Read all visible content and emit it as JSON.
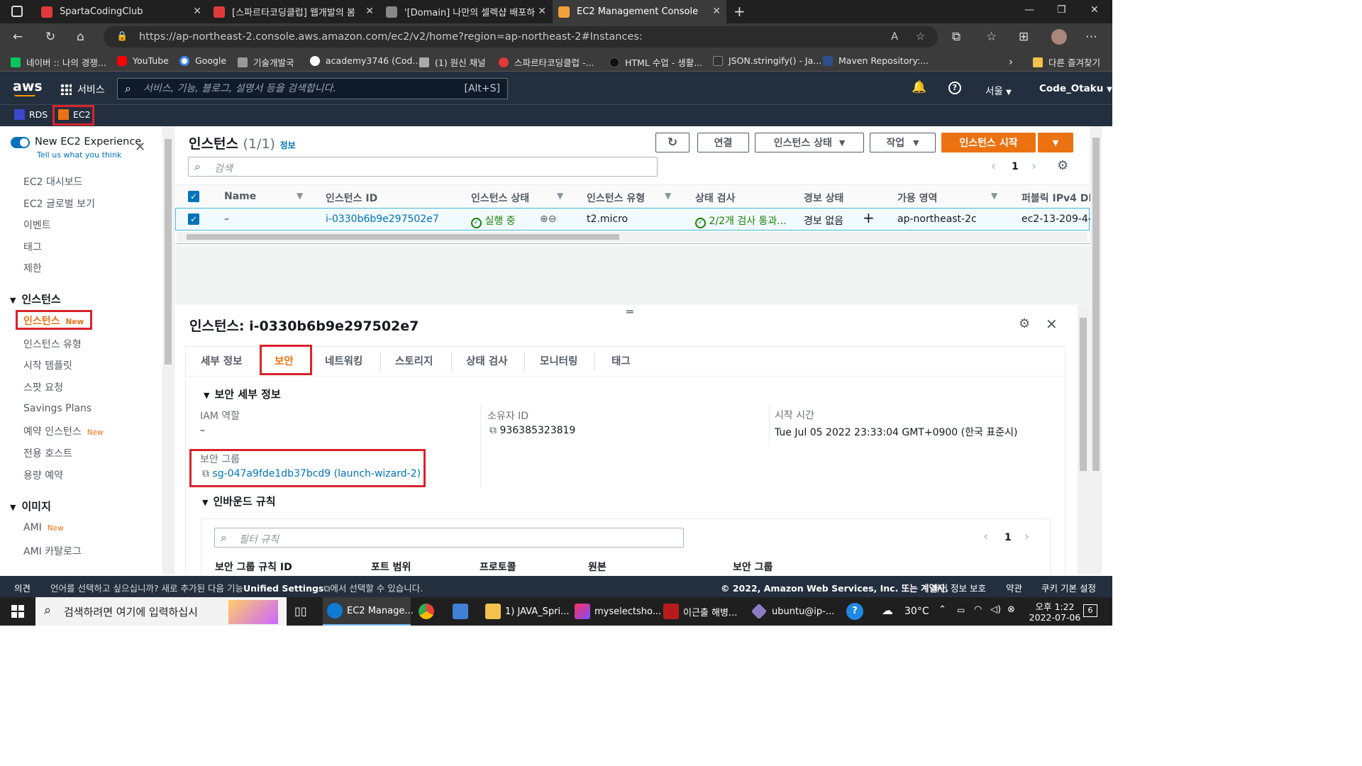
{
  "browser": {
    "tabs": [
      {
        "title": "SpartaCodingClub",
        "color": "#e03a3a"
      },
      {
        "title": "[스파르타코딩클럽] 웹개발의 봄",
        "color": "#e03a3a"
      },
      {
        "title": "'[Domain] 나만의 셀렉샵 배포하",
        "color": "#888888"
      },
      {
        "title": "EC2 Management Console",
        "color": "#f2a03a"
      }
    ],
    "url": "https://ap-northeast-2.console.aws.amazon.com/ec2/v2/home?region=ap-northeast-2#Instances:",
    "bookmarks": [
      {
        "label": "네이버 :: 나의 경쟁...",
        "color": "#03c75a"
      },
      {
        "label": "YouTube",
        "color": "#ff0000"
      },
      {
        "label": "Google",
        "color": "#4285f4"
      },
      {
        "label": "기술개발국",
        "color": "#999999"
      },
      {
        "label": "academy3746 (Cod...",
        "color": "#ffffff"
      },
      {
        "label": "(1) 원신 채널",
        "color": "#aaaaaa"
      },
      {
        "label": "스파르타코딩클럽 -...",
        "color": "#e03a3a"
      },
      {
        "label": "HTML 수업 - 생활...",
        "color": "#111111"
      },
      {
        "label": "JSON.stringify() - Ja...",
        "color": "#333333"
      },
      {
        "label": "Maven Repository:...",
        "color": "#2d4e8a"
      }
    ],
    "other_bookmarks": "다른 즐겨찾기"
  },
  "aws": {
    "logo": "aws",
    "services": "서비스",
    "search_placeholder": "서비스, 기능, 블로그, 설명서 등을 검색합니다.",
    "search_shortcut": "[Alt+S]",
    "region": "서울",
    "user": "Code_Otaku",
    "favorites": [
      "RDS",
      "EC2"
    ]
  },
  "sidebar": {
    "new_experience": "New EC2 Experience",
    "tell_us": "Tell us what you think",
    "top_items": [
      "EC2 대시보드",
      "EC2 글로벌 보기",
      "이벤트",
      "태그",
      "제한"
    ],
    "section_instances": "인스턴스",
    "instance_items": [
      {
        "label": "인스턴스",
        "badge": "New"
      },
      {
        "label": "인스턴스 유형",
        "badge": ""
      },
      {
        "label": "시작 템플릿",
        "badge": ""
      },
      {
        "label": "스팟 요청",
        "badge": ""
      },
      {
        "label": "Savings Plans",
        "badge": ""
      },
      {
        "label": "예약 인스턴스",
        "badge": "New"
      },
      {
        "label": "전용 호스트",
        "badge": ""
      },
      {
        "label": "용량 예약",
        "badge": ""
      }
    ],
    "section_images": "이미지",
    "image_items": [
      {
        "label": "AMI",
        "badge": "New"
      },
      {
        "label": "AMI 카탈로그",
        "badge": ""
      }
    ]
  },
  "instances": {
    "title": "인스턴스",
    "count": "(1/1)",
    "info": "정보",
    "buttons": {
      "connect": "연결",
      "state": "인스턴스 상태",
      "actions": "작업",
      "launch": "인스턴스 시작"
    },
    "search_placeholder": "검색",
    "page": "1",
    "columns": [
      "Name",
      "인스턴스 ID",
      "인스턴스 상태",
      "인스턴스 유형",
      "상태 검사",
      "경보 상태",
      "가용 영역",
      "퍼블릭 IPv4 DN"
    ],
    "row": {
      "name": "–",
      "id": "i-0330b6b9e297502e7",
      "state": "실행 중",
      "type": "t2.micro",
      "check": "2/2개 검사 통과...",
      "alarm": "경보 없음",
      "az": "ap-northeast-2c",
      "dns": "ec2-13-209-4-"
    }
  },
  "detail": {
    "title": "인스턴스: i-0330b6b9e297502e7",
    "tabs": [
      "세부 정보",
      "보안",
      "네트워킹",
      "스토리지",
      "상태 검사",
      "모니터링",
      "태그"
    ],
    "section_security": "보안 세부 정보",
    "iam_label": "IAM 역할",
    "iam_value": "–",
    "owner_label": "소유자 ID",
    "owner_value": "936385323819",
    "launch_label": "시작 시간",
    "launch_value": "Tue Jul 05 2022 23:33:04 GMT+0900 (한국 표준시)",
    "sg_label": "보안 그룹",
    "sg_value": "sg-047a9fde1db37bcd9 (launch-wizard-2)",
    "section_inbound": "인바운드 규칙",
    "filter_placeholder": "필터 규칙",
    "page": "1",
    "inbound_columns": [
      "보안 그룹 규칙 ID",
      "포트 범위",
      "프로토콜",
      "원본",
      "보안 그룹"
    ]
  },
  "footer": {
    "feedback": "의견",
    "language_msg_prefix": "언어를 선택하고 싶으십니까? 새로 추가된 다음 기능",
    "unified_settings": "Unified Settings",
    "language_msg_suffix": "에서 선택할 수 있습니다.",
    "copyright": "© 2022, Amazon Web Services, Inc. 또는 계열사.",
    "privacy": "개인 정보 보호",
    "terms": "약관",
    "cookies": "쿠키 기본 설정"
  },
  "taskbar": {
    "search": "검색하려면 여기에 입력하십시",
    "apps": [
      {
        "label": "EC2 Manage...",
        "color": "#0e7bd6"
      },
      {
        "label": "",
        "color": "#e94235"
      },
      {
        "label": "",
        "color": "#3f7fd6"
      },
      {
        "label": "1) JAVA_Spri...",
        "color": "#f2c14e"
      },
      {
        "label": "myselectsho...",
        "color": "#c2185b"
      },
      {
        "label": "이근출 해병...",
        "color": "#b71c1c"
      },
      {
        "label": "ubuntu@ip-...",
        "color": "#8e7cc3"
      }
    ],
    "weather": "30°C",
    "time": "오후 1:22",
    "date": "2022-07-06",
    "notif": "6"
  }
}
